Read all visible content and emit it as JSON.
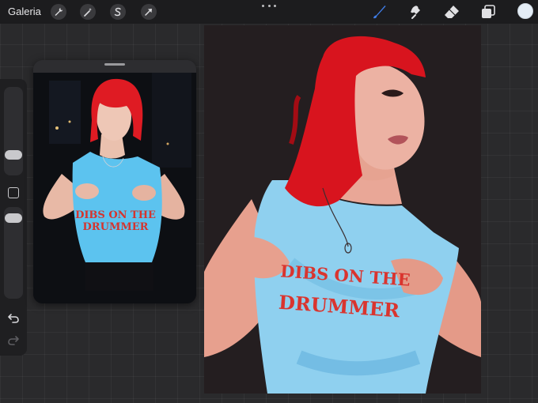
{
  "topbar": {
    "gallery_label": "Galeria",
    "left_tools": [
      "wrench-icon",
      "magic-wand-icon",
      "selection-s-icon",
      "arrow-transform-icon"
    ],
    "right_tools": [
      "brush-icon",
      "smudge-icon",
      "eraser-icon",
      "layers-icon"
    ],
    "active_tool": "brush",
    "accent_color": "#3f7de8",
    "current_color": "#e4edf6"
  },
  "sidebar": {
    "controls": [
      "brush-size-slider",
      "modify-button",
      "opacity-slider",
      "undo-icon",
      "redo-icon"
    ]
  },
  "reference": {
    "shirt_text_line1": "DIBS ON THE",
    "shirt_text_line2": "DRUMMER"
  },
  "canvas": {
    "shirt_text_line1": "DIBS ON THE",
    "shirt_text_line2": "DRUMMER",
    "colors": {
      "background": "#241e20",
      "hair": "#d8141e",
      "skin": "#e7a08e",
      "shirt": "#8fd0ef",
      "text": "#d9352f"
    }
  }
}
